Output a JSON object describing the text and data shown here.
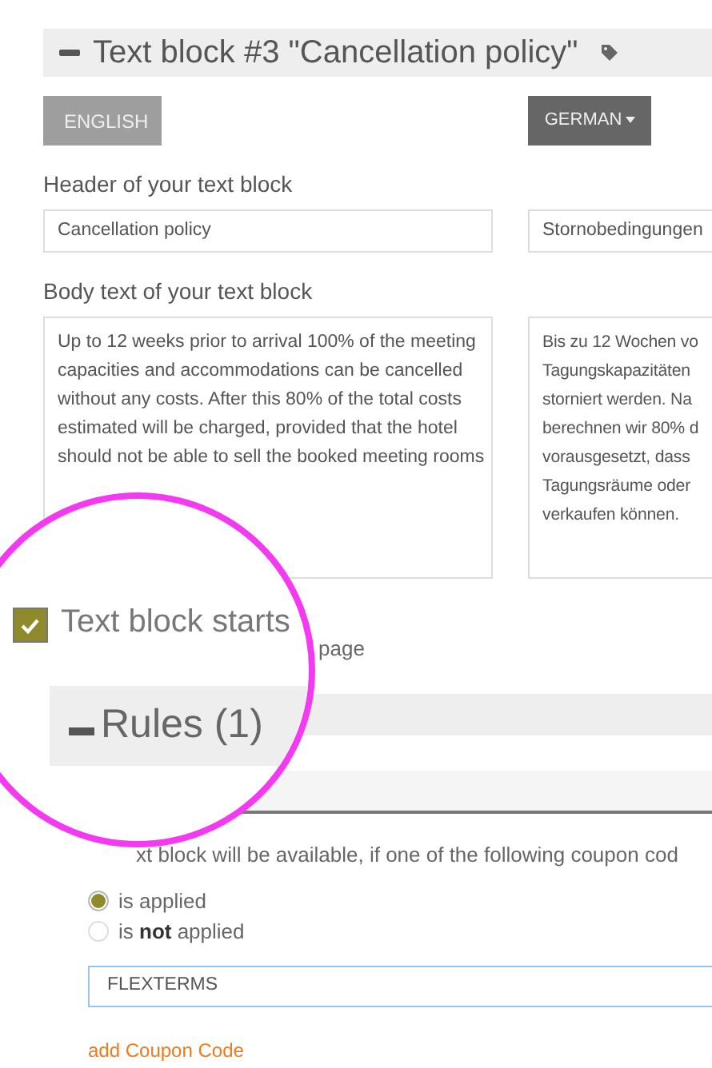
{
  "text_block": {
    "title": "Text block #3 \"Cancellation policy\"",
    "languages": [
      {
        "label": "ENGLISH",
        "kind": "button"
      },
      {
        "label": "GERMAN",
        "kind": "dropdown"
      }
    ],
    "header_label": "Header of your text block",
    "header_fields": [
      "Cancellation policy",
      "Stornobedingungen"
    ],
    "body_label": "Body text of your text block",
    "body_fields": [
      [
        "Up to 12 weeks prior to arrival 100% of the meeting",
        "capacities and accommodations can be cancelled",
        "without any costs. After this 80% of the total costs",
        "estimated will be charged, provided that the hotel",
        "should not be able to sell the booked meeting rooms"
      ],
      [
        "Bis zu 12 Wochen vo",
        "Tagungskapazitäten",
        "storniert werden. Na",
        "berechnen wir 80% d",
        "vorausgesetzt, dass",
        "Tagungsräume oder",
        "verkaufen können."
      ]
    ],
    "new_page": {
      "checked": true,
      "label_magnified": "Text block starts",
      "label_rest": "page"
    }
  },
  "rules": {
    "title": "Rules (1)",
    "description": "xt block will be available, if one of the following coupon cod",
    "options": [
      {
        "label": "is applied",
        "selected": true
      },
      {
        "label": "is **not** applied",
        "selected": false
      }
    ],
    "coupon_code": "FLEXTERMS",
    "add_link": "add Coupon Code"
  }
}
